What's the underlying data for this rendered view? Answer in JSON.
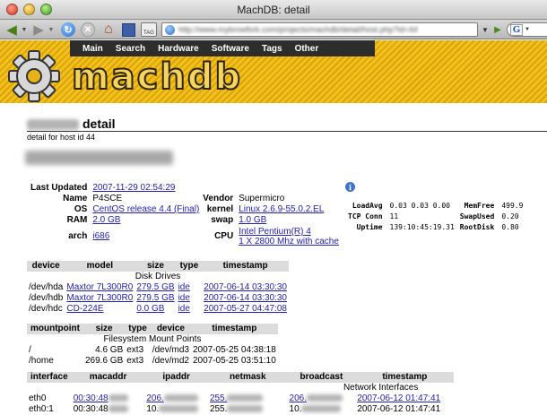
{
  "window": {
    "title": "MachDB:  detail"
  },
  "browser": {
    "url": "http://www.mybrowfork.com/projects/machdb/detail/host.php?id=44",
    "search_logo": "G",
    "tag_label": "TAG"
  },
  "nav": {
    "items": [
      "Main",
      "Search",
      "Hardware",
      "Software",
      "Tags",
      "Other"
    ]
  },
  "logo": {
    "text": "machdb"
  },
  "page": {
    "title_suffix": "detail",
    "subtitle": "detail for host id 44"
  },
  "summary": {
    "last_updated_label": "Last Updated",
    "last_updated": "2007-11-29 02:54:29",
    "name_label": "Name",
    "name": "P4SCE",
    "os_label": "OS",
    "os": "CentOS release 4.4 (Final)",
    "kernel_label": "kernel",
    "kernel": "Linux 2.6.9-55.0.2.EL",
    "vendor_label": "Vendor",
    "vendor": "Supermicro",
    "ram_label": "RAM",
    "ram": "2.0 GB",
    "swap_label": "swap",
    "swap": "1.0 GB",
    "arch_label": "arch",
    "arch": "i686",
    "cpu_label": "CPU",
    "cpu_line1": "Intel Pentium(R) 4",
    "cpu_line2": "1 X 2800 Mhz with cache"
  },
  "load": {
    "loadavg_label": "LoadAvg",
    "loadavg": "0.03 0.03 0.00",
    "memfree_label": "MemFree",
    "memfree": "499.9",
    "tcpconn_label": "TCP Conn",
    "tcpconn": "11",
    "swapused_label": "SwapUsed",
    "swapused": "0.20",
    "uptime_label": "Uptime",
    "uptime": "139:10:45:19.31",
    "rootdisk_label": "RootDisk",
    "rootdisk": "0.80"
  },
  "disks": {
    "caption": "Disk Drives",
    "headers": [
      "device",
      "model",
      "size",
      "type",
      "timestamp"
    ],
    "rows": [
      [
        "/dev/hda",
        "Maxtor 7L300R0",
        "279.5 GB",
        "ide",
        "2007-06-14 03:30:30"
      ],
      [
        "/dev/hdb",
        "Maxtor 7L300R0",
        "279.5 GB",
        "ide",
        "2007-06-14 03:30:30"
      ],
      [
        "/dev/hdc",
        "CD-224E",
        "0.0 GB",
        "ide",
        "2007-05-27 04:47:08"
      ]
    ]
  },
  "mounts": {
    "caption": "Filesystem Mount Points",
    "headers": [
      "mountpoint",
      "size",
      "type",
      "device",
      "timestamp"
    ],
    "rows": [
      [
        "/",
        "4.6 GB",
        "ext3",
        "/dev/md3",
        "2007-05-25 04:38:18"
      ],
      [
        "/home",
        "269.6 GB",
        "ext3",
        "/dev/md2",
        "2007-05-25 03:51:10"
      ]
    ]
  },
  "nics": {
    "caption": "Network Interfaces",
    "headers": [
      "interface",
      "macaddr",
      "ipaddr",
      "netmask",
      "broadcast",
      "timestamp"
    ],
    "rows": [
      [
        "eth0",
        "00:30:48",
        "206.",
        "255.",
        "206.",
        "2007-06-12 01:47:41"
      ],
      [
        "eth0:1",
        "00:30:48",
        "10.",
        "255.",
        "10.",
        "2007-06-12 01:47:41"
      ]
    ]
  }
}
